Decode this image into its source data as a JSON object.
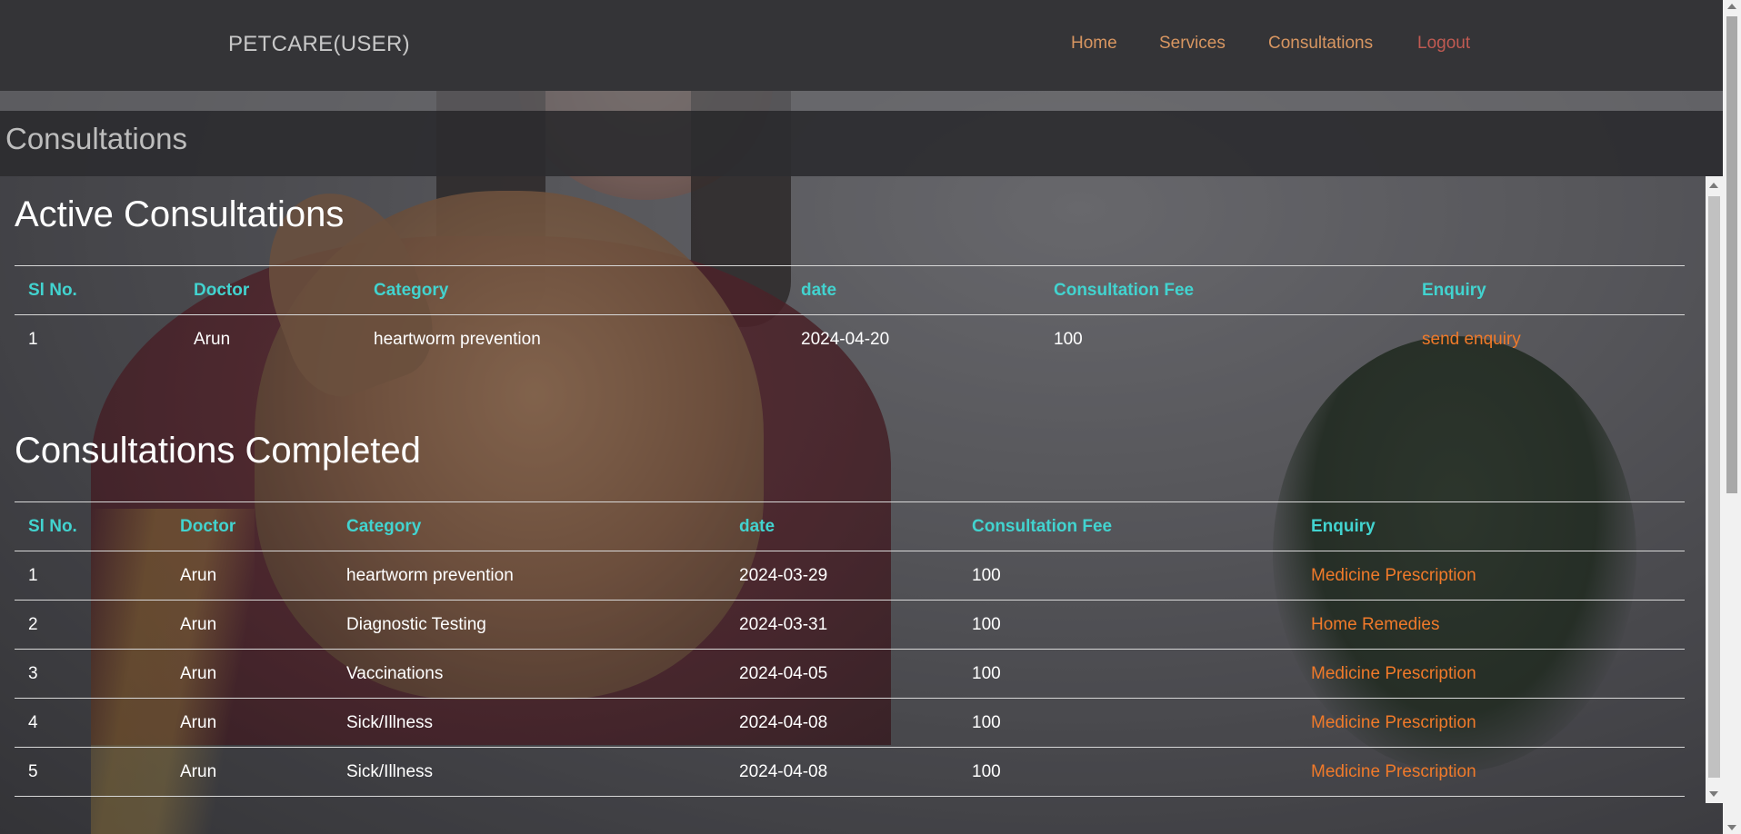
{
  "navbar": {
    "brand": "PETCARE(USER)",
    "links": [
      "Home",
      "Services",
      "Consultations"
    ],
    "logout": "Logout",
    "link_color": "#d89661",
    "logout_color": "#c05a52"
  },
  "page": {
    "title": "Consultations"
  },
  "active": {
    "heading": "Active Consultations",
    "columns": [
      "Sl No.",
      "Doctor",
      "Category",
      "date",
      "Consultation Fee",
      "Enquiry"
    ],
    "rows": [
      [
        "1",
        "Arun",
        "heartworm prevention",
        "2024-04-20",
        "100",
        "send enquiry"
      ]
    ]
  },
  "completed": {
    "heading": "Consultations Completed",
    "columns": [
      "Sl No.",
      "Doctor",
      "Category",
      "date",
      "Consultation Fee",
      "Enquiry"
    ],
    "rows": [
      [
        "1",
        "Arun",
        "heartworm prevention",
        "2024-03-29",
        "100",
        "Medicine Prescription"
      ],
      [
        "2",
        "Arun",
        "Diagnostic Testing",
        "2024-03-31",
        "100",
        "Home Remedies"
      ],
      [
        "3",
        "Arun",
        "Vaccinations",
        "2024-04-05",
        "100",
        "Medicine Prescription"
      ],
      [
        "4",
        "Arun",
        "Sick/Illness",
        "2024-04-08",
        "100",
        "Medicine Prescription"
      ],
      [
        "5",
        "Arun",
        "Sick/Illness",
        "2024-04-08",
        "100",
        "Medicine Prescription"
      ]
    ]
  },
  "colors": {
    "header_text": "#42d3cf",
    "link_text": "#f07a2a"
  }
}
